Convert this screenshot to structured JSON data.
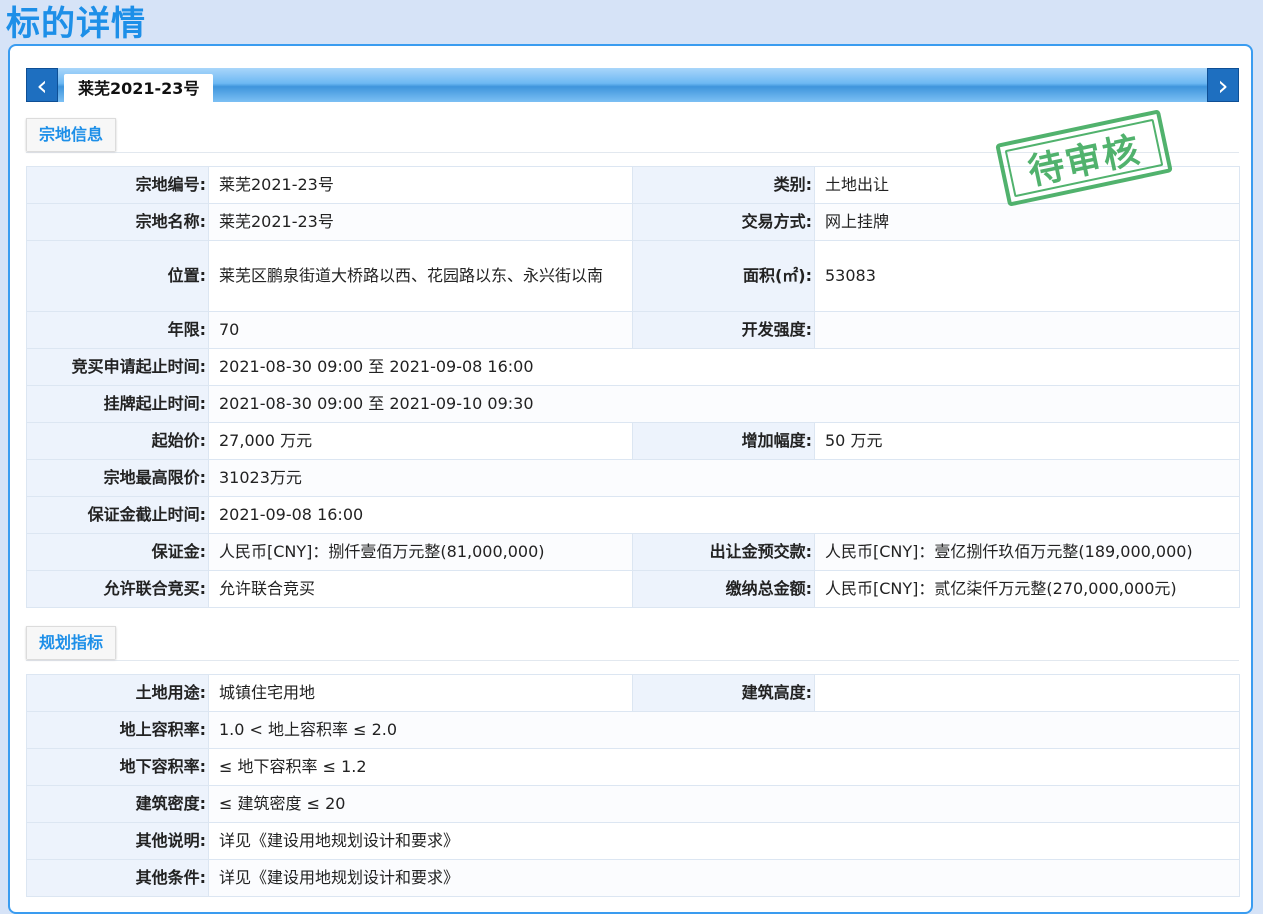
{
  "page_title": "标的详情",
  "tab": {
    "prev_icon": "chevron-left-icon",
    "next_icon": "chevron-right-icon",
    "active_label": "莱芜2021-23号"
  },
  "stamp_text": "待审核",
  "sections": {
    "land_info": {
      "label": "宗地信息",
      "rows": {
        "code_k": "宗地编号:",
        "code_v": "莱芜2021-23号",
        "category_k": "类别:",
        "category_v": "土地出让",
        "name_k": "宗地名称:",
        "name_v": "莱芜2021-23号",
        "trade_k": "交易方式:",
        "trade_v": "网上挂牌",
        "location_k": "位置:",
        "location_v": "莱芜区鹏泉街道大桥路以西、花园路以东、永兴街以南",
        "area_k": "面积(㎡):",
        "area_v": "53083",
        "term_k": "年限:",
        "term_v": "70",
        "intensity_k": "开发强度:",
        "intensity_v": "",
        "apply_time_k": "竞买申请起止时间:",
        "apply_time_v": "2021-08-30 09:00 至 2021-09-08 16:00",
        "listing_time_k": "挂牌起止时间:",
        "listing_time_v": "2021-08-30 09:00 至 2021-09-10 09:30",
        "start_price_k": "起始价:",
        "start_price_v": "27,000 万元",
        "increment_k": "增加幅度:",
        "increment_v": "50 万元",
        "max_price_k": "宗地最高限价:",
        "max_price_v": "31023万元",
        "deposit_deadline_k": "保证金截止时间:",
        "deposit_deadline_v": "2021-09-08 16:00",
        "deposit_k": "保证金:",
        "deposit_v": "人民币[CNY]：捌仟壹佰万元整(81,000,000)",
        "prepay_k": "出让金预交款:",
        "prepay_v": "人民币[CNY]：壹亿捌仟玖佰万元整(189,000,000)",
        "joint_k": "允许联合竞买:",
        "joint_v": "允许联合竞买",
        "total_k": "缴纳总金额:",
        "total_v": "人民币[CNY]：贰亿柒仟万元整(270,000,000元)"
      }
    },
    "planning": {
      "label": "规划指标",
      "rows": {
        "use_k": "土地用途:",
        "use_v": "城镇住宅用地",
        "height_k": "建筑高度:",
        "height_v": "",
        "far_above_k": "地上容积率:",
        "far_above_v": "1.0 < 地上容积率 ≤ 2.0",
        "far_below_k": "地下容积率:",
        "far_below_v": "≤ 地下容积率 ≤ 1.2",
        "density_k": "建筑密度:",
        "density_v": "≤ 建筑密度 ≤ 20",
        "other_desc_k": "其他说明:",
        "other_desc_v": "详见《建设用地规划设计和要求》",
        "other_cond_k": "其他条件:",
        "other_cond_v": "详见《建设用地规划设计和要求》"
      }
    }
  }
}
